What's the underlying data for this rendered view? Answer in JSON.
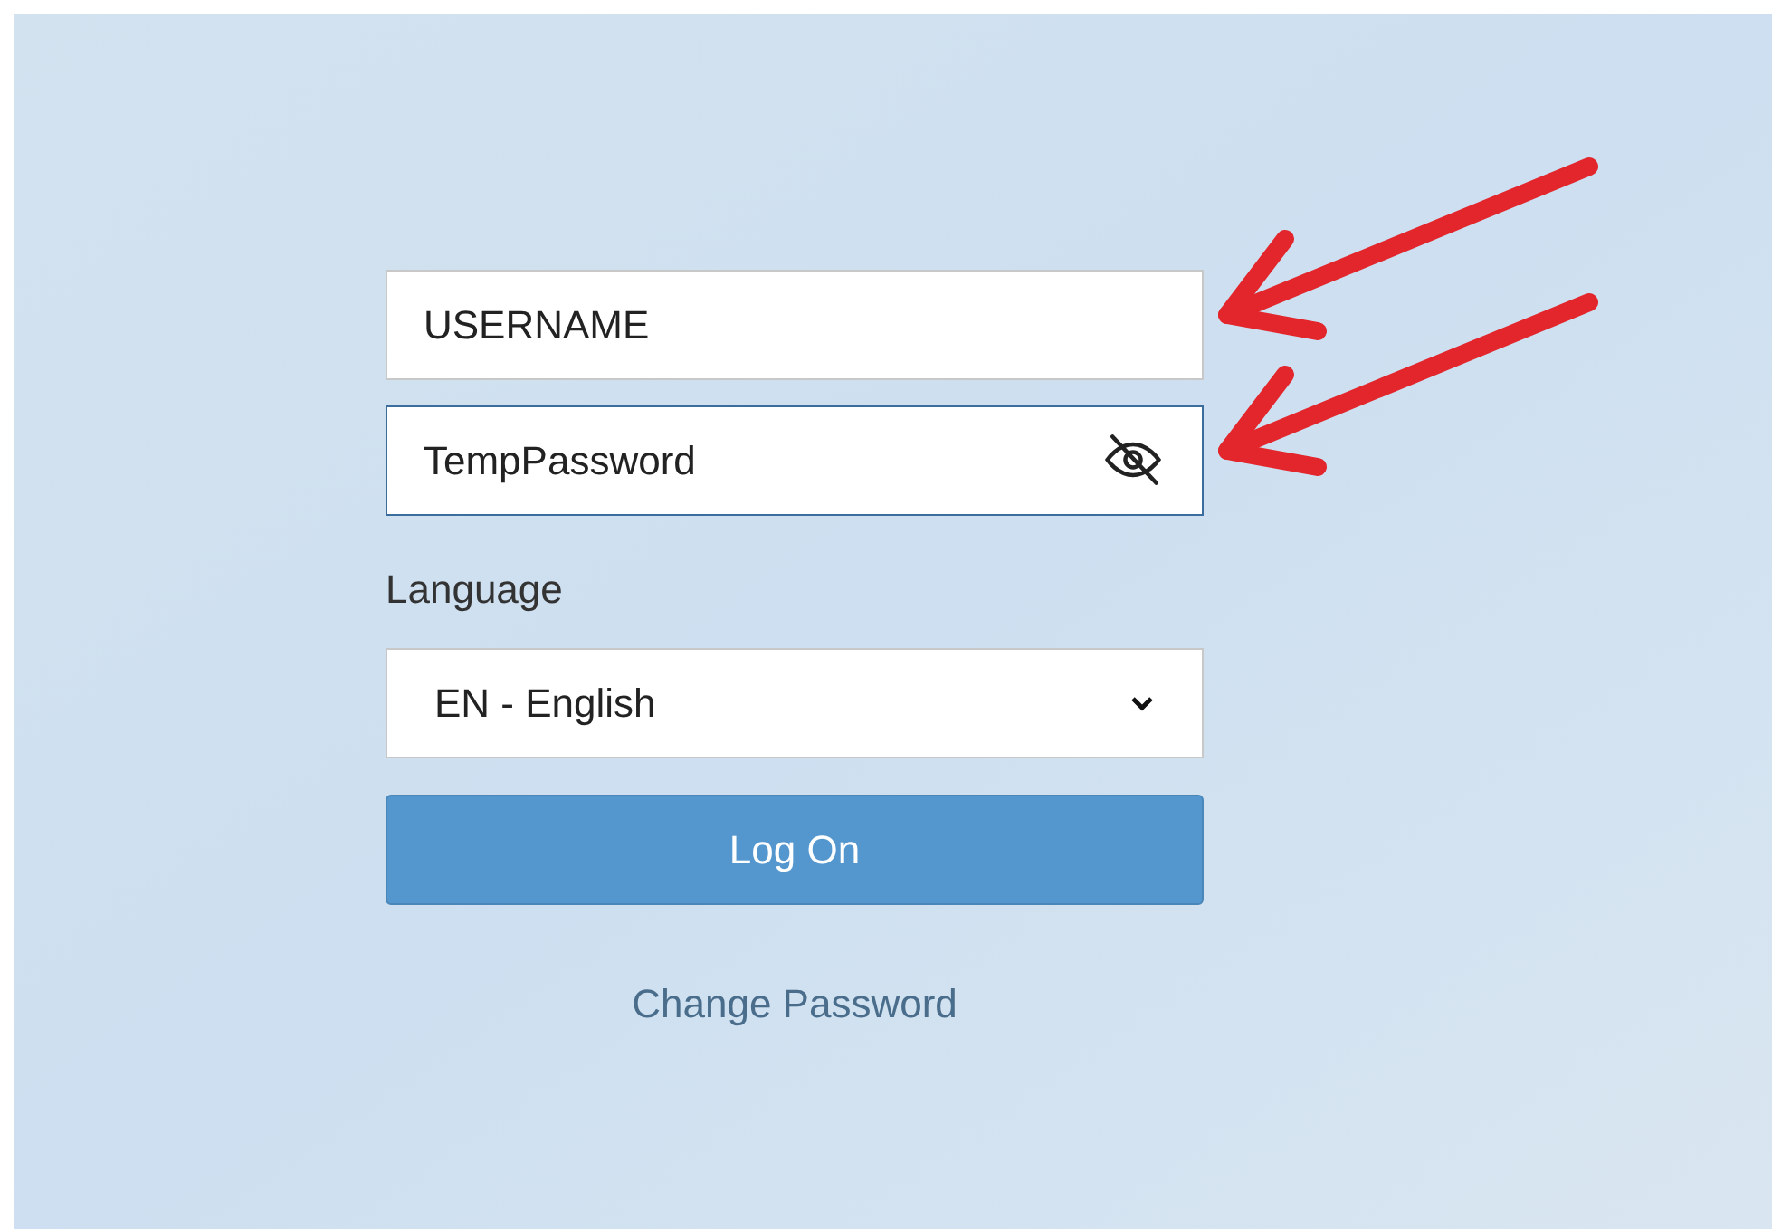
{
  "username": {
    "value": "USERNAME"
  },
  "password": {
    "value": "TempPassword",
    "focused": true
  },
  "language": {
    "label": "Language",
    "value": "EN - English"
  },
  "login_button": {
    "label": "Log On"
  },
  "change_password_link": {
    "label": "Change Password"
  },
  "annotations": [
    {
      "kind": "arrow"
    },
    {
      "kind": "arrow"
    }
  ]
}
